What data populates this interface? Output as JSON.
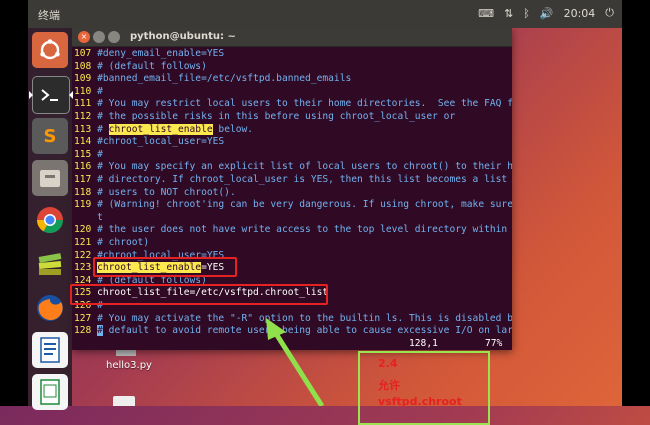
{
  "top_panel": {
    "app_name": "终端",
    "time": "20:04",
    "tray_icons": [
      "keyboard-icon",
      "sort-icon",
      "bluetooth-icon",
      "volume-icon",
      "power-icon"
    ]
  },
  "launcher": {
    "items": [
      "ubuntu-dash",
      "terminal",
      "sublime-text",
      "files",
      "chrome",
      "stack",
      "firefox",
      "writer",
      "calc"
    ]
  },
  "window": {
    "title": "python@ubuntu: ~"
  },
  "terminal_lines": [
    {
      "n": "107",
      "segments": [
        {
          "t": "#deny_email_enable=YES",
          "c": "cm"
        }
      ]
    },
    {
      "n": "108",
      "segments": [
        {
          "t": "# (default follows)",
          "c": "cm"
        }
      ]
    },
    {
      "n": "109",
      "segments": [
        {
          "t": "#banned_email_file=/etc/vsftpd.banned_emails",
          "c": "cm"
        }
      ]
    },
    {
      "n": "110",
      "segments": [
        {
          "t": "#",
          "c": "cm"
        }
      ]
    },
    {
      "n": "111",
      "segments": [
        {
          "t": "# You may restrict local users to their home directories.  See the FAQ for",
          "c": "cm"
        }
      ]
    },
    {
      "n": "112",
      "segments": [
        {
          "t": "# the possible risks in this before using chroot_local_user or",
          "c": "cm"
        }
      ]
    },
    {
      "n": "113",
      "segments": [
        {
          "t": "# ",
          "c": "cm"
        },
        {
          "t": "chroot_list_enable",
          "c": "hl"
        },
        {
          "t": " below.",
          "c": "cm"
        }
      ]
    },
    {
      "n": "114",
      "segments": [
        {
          "t": "#chroot_local_user=YES",
          "c": "cm"
        }
      ]
    },
    {
      "n": "115",
      "segments": [
        {
          "t": "#",
          "c": "cm"
        }
      ]
    },
    {
      "n": "116",
      "segments": [
        {
          "t": "# You may specify an explicit list of local users to chroot() to their home",
          "c": "cm"
        }
      ]
    },
    {
      "n": "117",
      "segments": [
        {
          "t": "# directory. If chroot_local_user is YES, then this list becomes a list of",
          "c": "cm"
        }
      ]
    },
    {
      "n": "118",
      "segments": [
        {
          "t": "# users to NOT chroot().",
          "c": "cm"
        }
      ]
    },
    {
      "n": "119",
      "segments": [
        {
          "t": "# (Warning! chroot'ing can be very dangerous. If using chroot, make sure tha",
          "c": "cm"
        }
      ]
    },
    {
      "n": "",
      "segments": [
        {
          "t": "t",
          "c": "cm"
        }
      ]
    },
    {
      "n": "120",
      "segments": [
        {
          "t": "# the user does not have write access to the top level directory within the",
          "c": "cm"
        }
      ]
    },
    {
      "n": "121",
      "segments": [
        {
          "t": "# chroot)",
          "c": "cm"
        }
      ]
    },
    {
      "n": "122",
      "segments": [
        {
          "t": "#chroot_local_user=YES",
          "c": "cm"
        }
      ]
    },
    {
      "n": "123",
      "segments": [
        {
          "t": "chroot_list_enable",
          "c": "hl"
        },
        {
          "t": "=YES",
          "c": "df"
        }
      ]
    },
    {
      "n": "124",
      "segments": [
        {
          "t": "# (default follows)",
          "c": "cm"
        }
      ]
    },
    {
      "n": "125",
      "segments": [
        {
          "t": "chroot_list_file=/etc/vsftpd.chroot_list",
          "c": "df"
        }
      ]
    },
    {
      "n": "126",
      "segments": [
        {
          "t": "#",
          "c": "cm"
        }
      ]
    },
    {
      "n": "127",
      "segments": [
        {
          "t": "# You may activate the \"-R\" option to the builtin ls. This is disabled by",
          "c": "cm"
        }
      ]
    },
    {
      "n": "128",
      "segments": [
        {
          "t": "#",
          "c": "cursor"
        },
        {
          "t": " default to avoid remote users being able to cause excessive I/O on large",
          "c": "cm"
        }
      ]
    }
  ],
  "status_line": {
    "position": "128,1",
    "percent": "77%"
  },
  "desktop": {
    "file_label": "hello3.py"
  },
  "annotation": {
    "line1": "2.4",
    "line2": "允许",
    "line3": "vsftpd.chroot"
  },
  "colors": {
    "terminal_bg": "#300a24",
    "line_number": "#fce94f",
    "comment": "#72b1f0",
    "highlight": "#fce94f",
    "annotation_red": "#e52121",
    "arrow_green": "#8fe04a"
  }
}
